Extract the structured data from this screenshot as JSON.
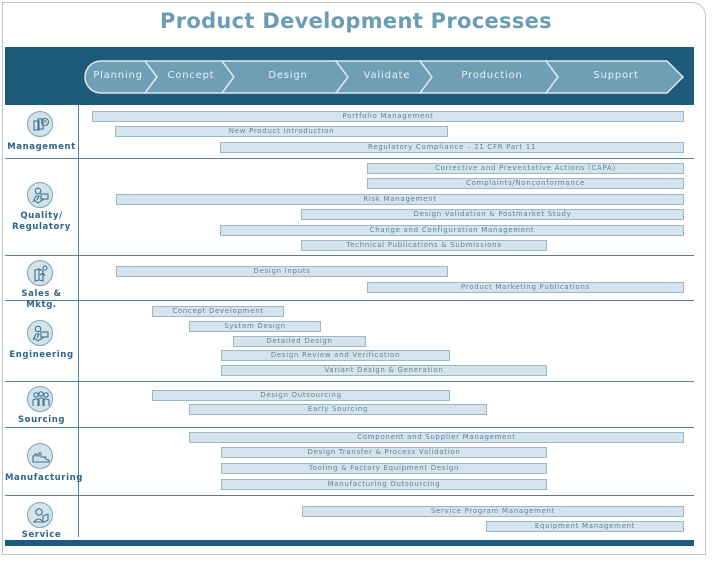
{
  "title": "Product Development Processes",
  "colors": {
    "banner": "#1d5a7c",
    "phase_fill": "#6f9fb5",
    "bar_fill": "#d5e4ec",
    "title": "#6a9db3",
    "category_label": "#2d6584"
  },
  "phases": [
    {
      "label": "Planning"
    },
    {
      "label": "Concept"
    },
    {
      "label": "Design"
    },
    {
      "label": "Validate"
    },
    {
      "label": "Production"
    },
    {
      "label": "Support"
    }
  ],
  "categories": [
    {
      "label": "Management",
      "icon": "documents-clock-icon",
      "bars": [
        {
          "label": "Portfolio Management"
        },
        {
          "label": "New Product Introduction"
        },
        {
          "label": "Regulatory Compliance – 21 CFR Part 11"
        }
      ]
    },
    {
      "label": "Quality/\nRegulatory",
      "icon": "person-computer-icon",
      "bars": [
        {
          "label": "Corrective and Preventative Actions (CAPA)"
        },
        {
          "label": "Complaints/Nonconformance"
        },
        {
          "label": "Risk Management"
        },
        {
          "label": "Design Validation & Postmarket Study"
        },
        {
          "label": "Change and Configuration Management"
        },
        {
          "label": "Technical Publications & Submissions"
        }
      ]
    },
    {
      "label": "Sales & Mktg.",
      "icon": "map-person-icon",
      "bars": [
        {
          "label": "Design Inputs"
        },
        {
          "label": "Product Marketing Publications"
        }
      ]
    },
    {
      "label": "Engineering",
      "icon": "person-computer-icon",
      "bars": [
        {
          "label": "Concept Development"
        },
        {
          "label": "System Design"
        },
        {
          "label": "Detailed Design"
        },
        {
          "label": "Design Review and Verification"
        },
        {
          "label": "Variant Design & Generation"
        }
      ]
    },
    {
      "label": "Sourcing",
      "icon": "group-people-icon",
      "bars": [
        {
          "label": "Design Outsourcing"
        },
        {
          "label": "Early Sourcing"
        }
      ]
    },
    {
      "label": "Manufacturing",
      "icon": "factory-icon",
      "bars": [
        {
          "label": "Component and Supplier Management"
        },
        {
          "label": "Design Transfer & Process Validation"
        },
        {
          "label": "Tooling & Factory Equipment Design"
        },
        {
          "label": "Manufacturing Outsourcing"
        }
      ]
    },
    {
      "label": "Service",
      "icon": "person-document-icon",
      "bars": [
        {
          "label": "Service Program Management"
        },
        {
          "label": "Equipment Management"
        }
      ]
    }
  ]
}
